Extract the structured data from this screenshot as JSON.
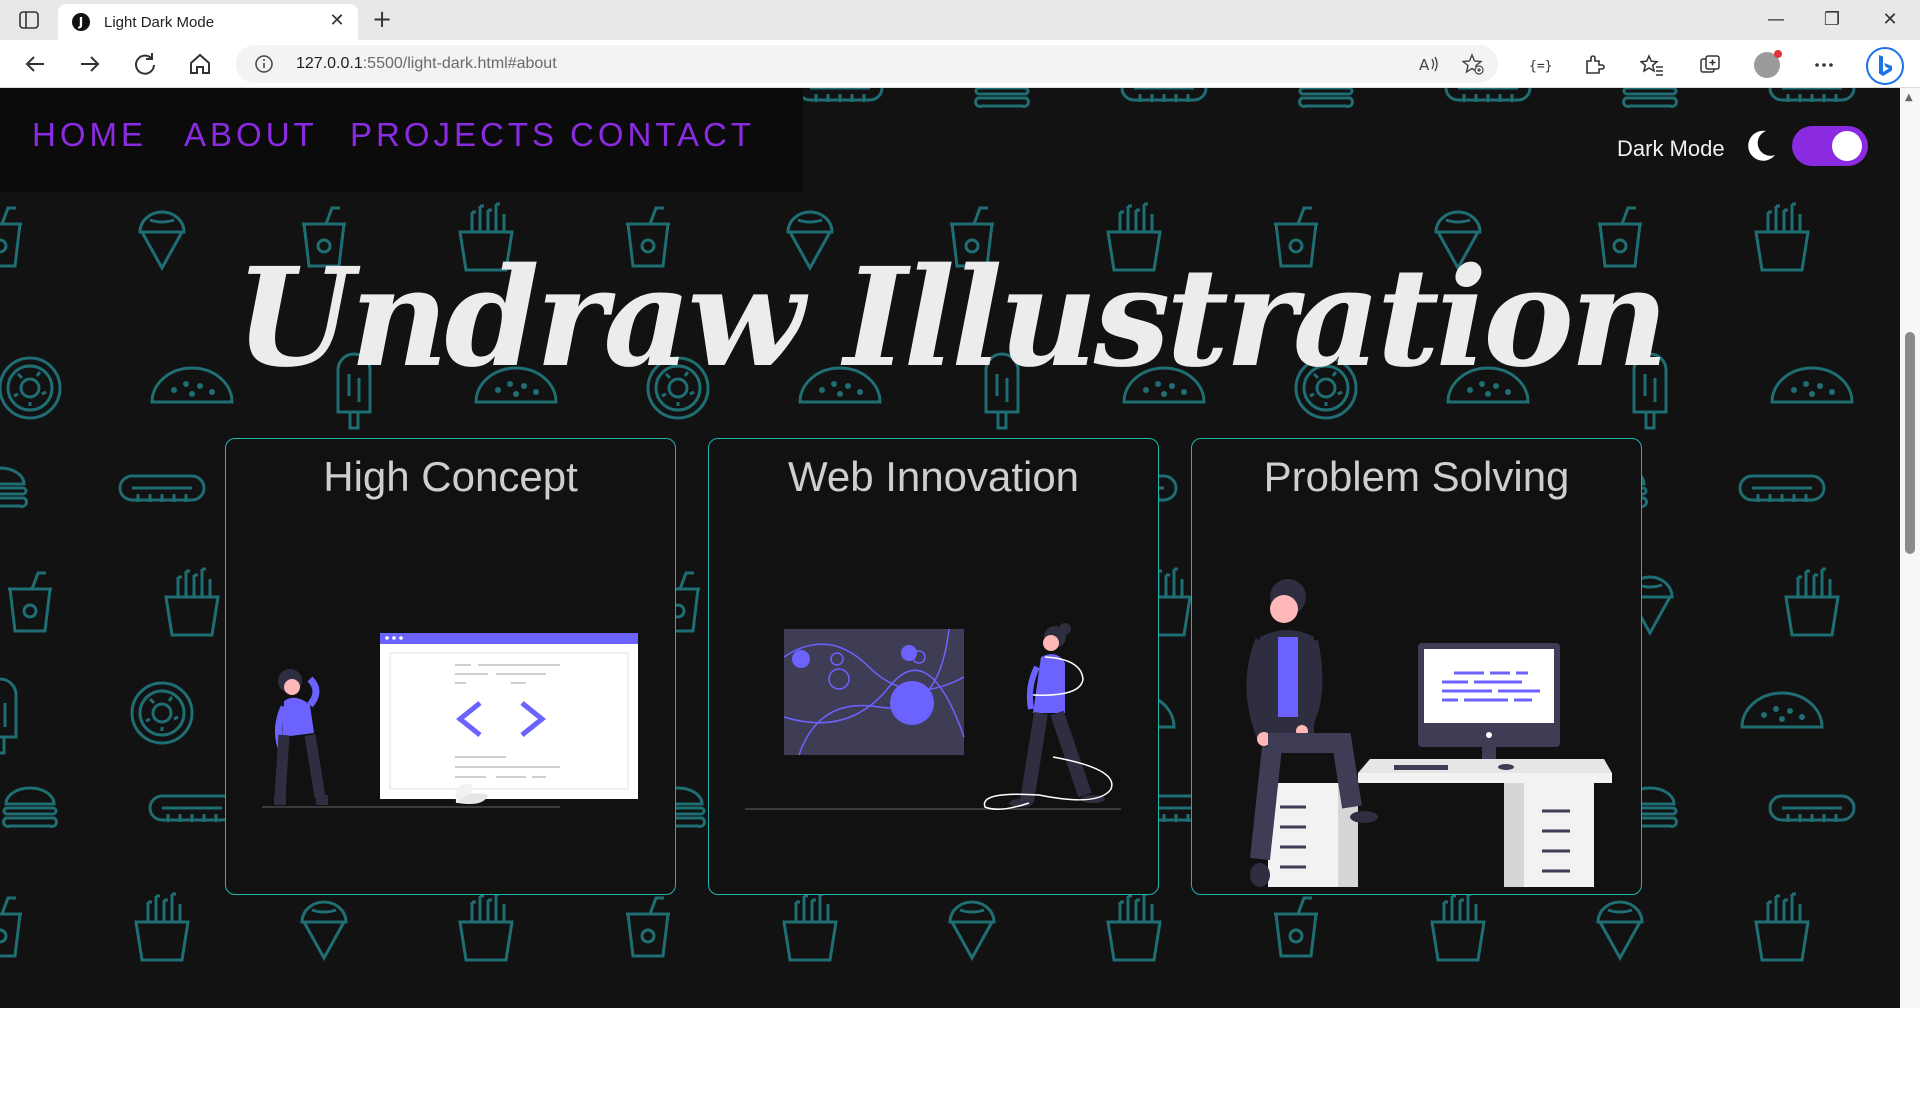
{
  "browser": {
    "tab_title": "Light Dark Mode",
    "tab_favicon": "J",
    "address_host": "127.0.0.1",
    "address_rest": ":5500/light-dark.html#about"
  },
  "nav": {
    "links": [
      "HOME",
      "ABOUT",
      "PROJECTS",
      "CONTACT"
    ]
  },
  "theme_toggle": {
    "label": "Dark Mode",
    "state": "on",
    "icon": "moon-icon"
  },
  "hero": {
    "title": "Undraw Illustration"
  },
  "cards": [
    {
      "title": "High Concept"
    },
    {
      "title": "Web Innovation"
    },
    {
      "title": "Problem Solving"
    }
  ],
  "colors": {
    "accent": "#8a2be2",
    "card_border": "#1fb5ad",
    "pattern": "#1f6e73",
    "illustration": "#6c63ff",
    "background": "#121212"
  }
}
